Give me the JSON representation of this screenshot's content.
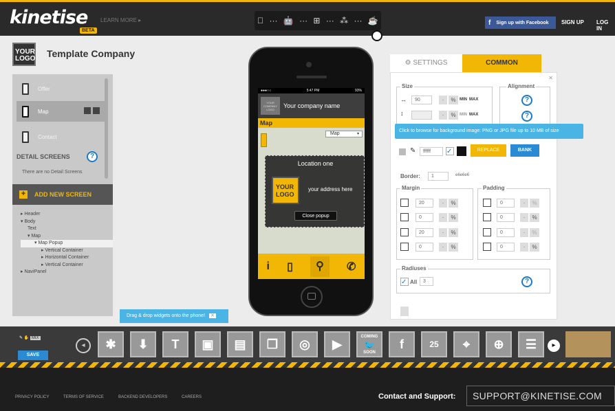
{
  "header": {
    "logo": "kinetise",
    "beta": "BETA",
    "learn_more": "LEARN MORE ▸",
    "platforms": [
      "",
      "···",
      "",
      "···",
      "",
      "···",
      "",
      "···",
      ""
    ],
    "facebook": "Sign up with Facebook",
    "signup": "SIGN UP",
    "login": "LOG IN"
  },
  "company": {
    "logo_text": "YOUR LOGO",
    "name": "Template Company"
  },
  "screens": [
    {
      "label": "Offer"
    },
    {
      "label": "Map"
    },
    {
      "label": "Contact"
    }
  ],
  "detail": {
    "title": "DETAIL SCREENS",
    "empty": "There are no Detail Screens"
  },
  "add_screen": "ADD NEW SCREEN",
  "tree": [
    "▸ Header",
    "▾ Body",
    "Text",
    "▾ Map",
    "▾ Map Popup",
    "▸ Vertical Container",
    "▸ Horizontal Container",
    "▸ Vertical Container",
    "▸ NaviPanel"
  ],
  "phone": {
    "carrier": "●●●○○",
    "time": "5:47 PM",
    "battery": "93%",
    "company_logo": "YOUR COMPANY LOGO",
    "company_name": "Your company name",
    "screen_title": "Map",
    "map_select": "Map",
    "popup_title": "Location one",
    "popup_logo": "YOUR LOGO",
    "popup_address": "your address here",
    "popup_close": "Close popup",
    "footer_icons": [
      "i",
      "▯",
      "⚲",
      "✆"
    ]
  },
  "settings": {
    "tab_settings": "SETTINGS",
    "tab_common": "COMMON",
    "size": "Size",
    "alignment": "Alignment",
    "width_value": "90",
    "pct": "%",
    "min": "MIN",
    "max": "MAX",
    "tooltip": "Click to browse for background image: PNG or JPG file up to 10 MB of size",
    "bg_color": "ffffff",
    "replace": "REPLACE",
    "bank": "BANK",
    "border_label": "Border:",
    "border_value": "1",
    "border_color": "e6e6e6",
    "margin": "Margin",
    "padding": "Padding",
    "margin_values": [
      "20",
      "0",
      "20",
      "0"
    ],
    "padding_values": [
      "0",
      "0",
      "0",
      "0"
    ],
    "radiuses": "Radiuses",
    "all_label": "All",
    "all_value": "3",
    "help": "?"
  },
  "toolbar": {
    "drag_tip": "Drag & drop widgets onto the phone!",
    "close": "✕",
    "save": "SAVE",
    "mix": "MIX",
    "widgets": [
      "◂",
      "✱",
      "⬇",
      "T",
      "▣",
      "▤",
      "❐",
      "◎",
      "▶",
      "COMING SOON",
      "f",
      "25",
      "⌖",
      "⊕",
      "☰",
      "●"
    ],
    "coming": "COMING",
    "soon": "SOON"
  },
  "footer": {
    "links": [
      "PRIVACY POLICY",
      "TERMS OF SERVICE",
      "BACKEND DEVELOPERS",
      "CAREERS"
    ],
    "contact": "Contact and Support:",
    "support": "SUPPORT@KINETISE.COM"
  }
}
